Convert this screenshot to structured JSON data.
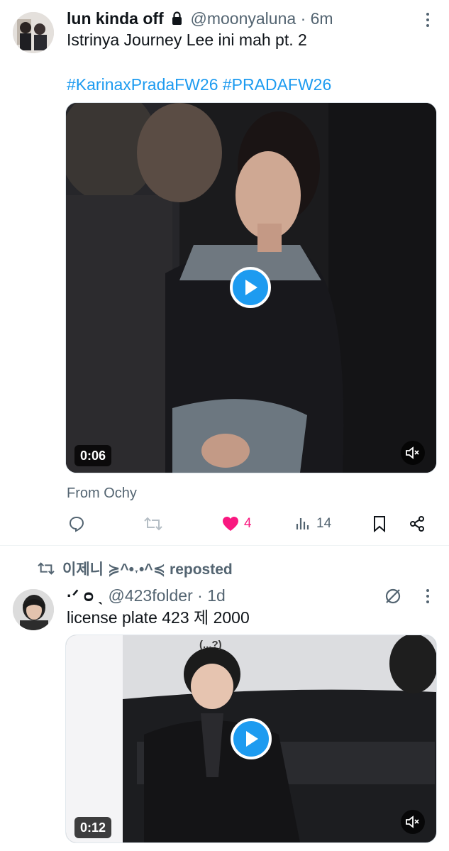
{
  "tweet1": {
    "display_name": "lun kinda off",
    "handle": "@moonyaluna",
    "separator": "·",
    "time": "6m",
    "text": "Istrinya Journey Lee ini mah pt. 2",
    "hashtags": [
      "#KarinaxPradaFW26",
      "#PRADAFW26"
    ],
    "video_duration": "0:06",
    "from_label": "From Ochy",
    "likes": "4",
    "views": "14",
    "liked_color": "#f91880"
  },
  "repost_banner": {
    "text": "이제니 ≽^•˕•^≼ reposted"
  },
  "tweet2": {
    "display_name": "·ᐟ ᴑ ˎ",
    "handle": "@423folder",
    "separator": "·",
    "time": "1d",
    "text": "license plate 423 제 2000",
    "video_duration": "0:12",
    "video_overlay_text": "(...?)"
  },
  "colors": {
    "accent": "#1d9bf0",
    "muted": "#536471",
    "text": "#0f1419"
  }
}
